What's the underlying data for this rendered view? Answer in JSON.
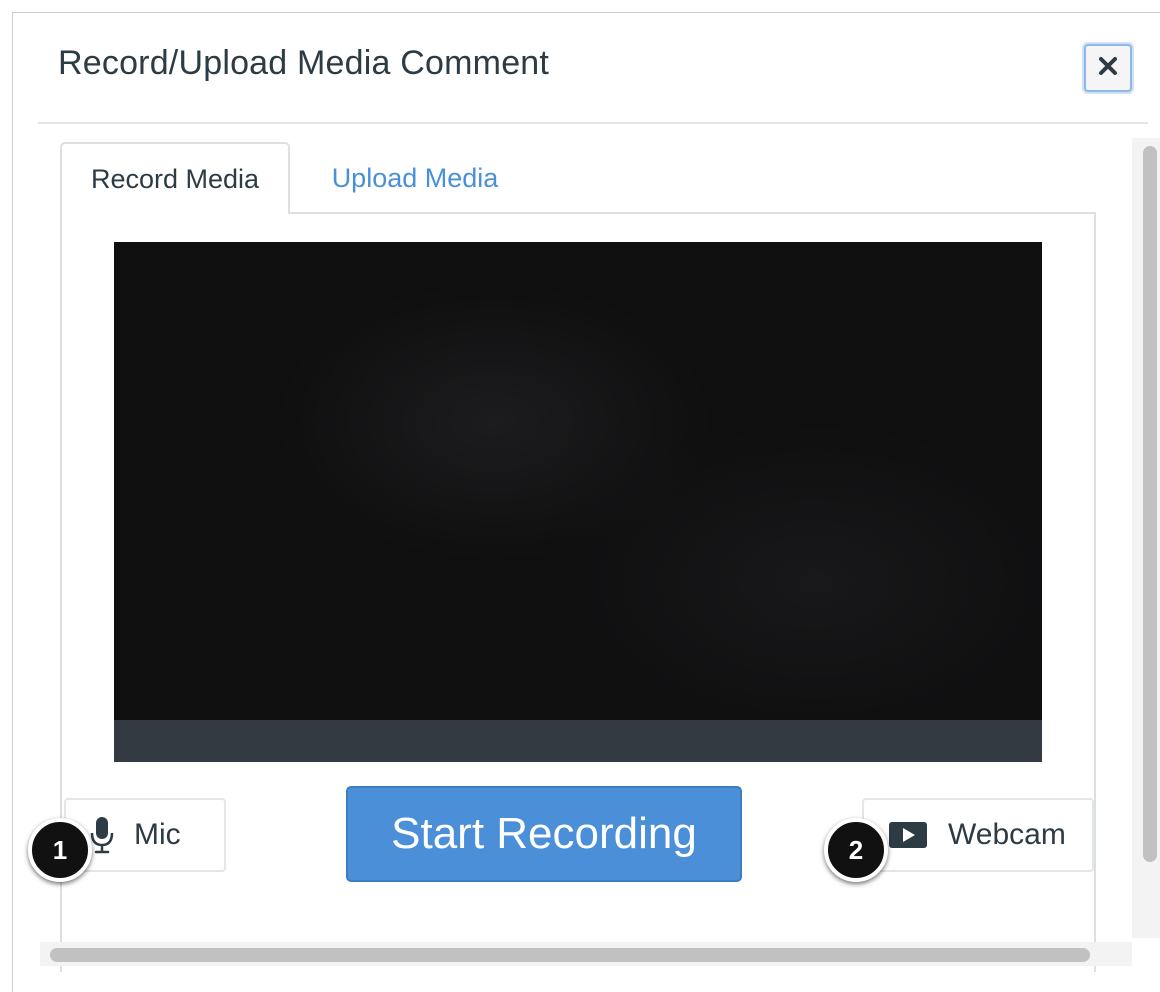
{
  "dialog": {
    "title": "Record/Upload Media Comment",
    "close_icon": "close-icon"
  },
  "tabs": [
    {
      "label": "Record Media",
      "active": true
    },
    {
      "label": "Upload Media",
      "active": false
    }
  ],
  "recorder": {
    "mic_label": "Mic",
    "mic_icon": "microphone-icon",
    "start_label": "Start Recording",
    "webcam_label": "Webcam",
    "webcam_icon": "webcam-icon"
  },
  "callouts": [
    {
      "number": "1"
    },
    {
      "number": "2"
    }
  ],
  "colors": {
    "accent": "#4a8fd8",
    "link": "#4a90d9",
    "text": "#2d3b45",
    "video_background": "#0f0f10",
    "video_controlbar": "#343a42"
  }
}
